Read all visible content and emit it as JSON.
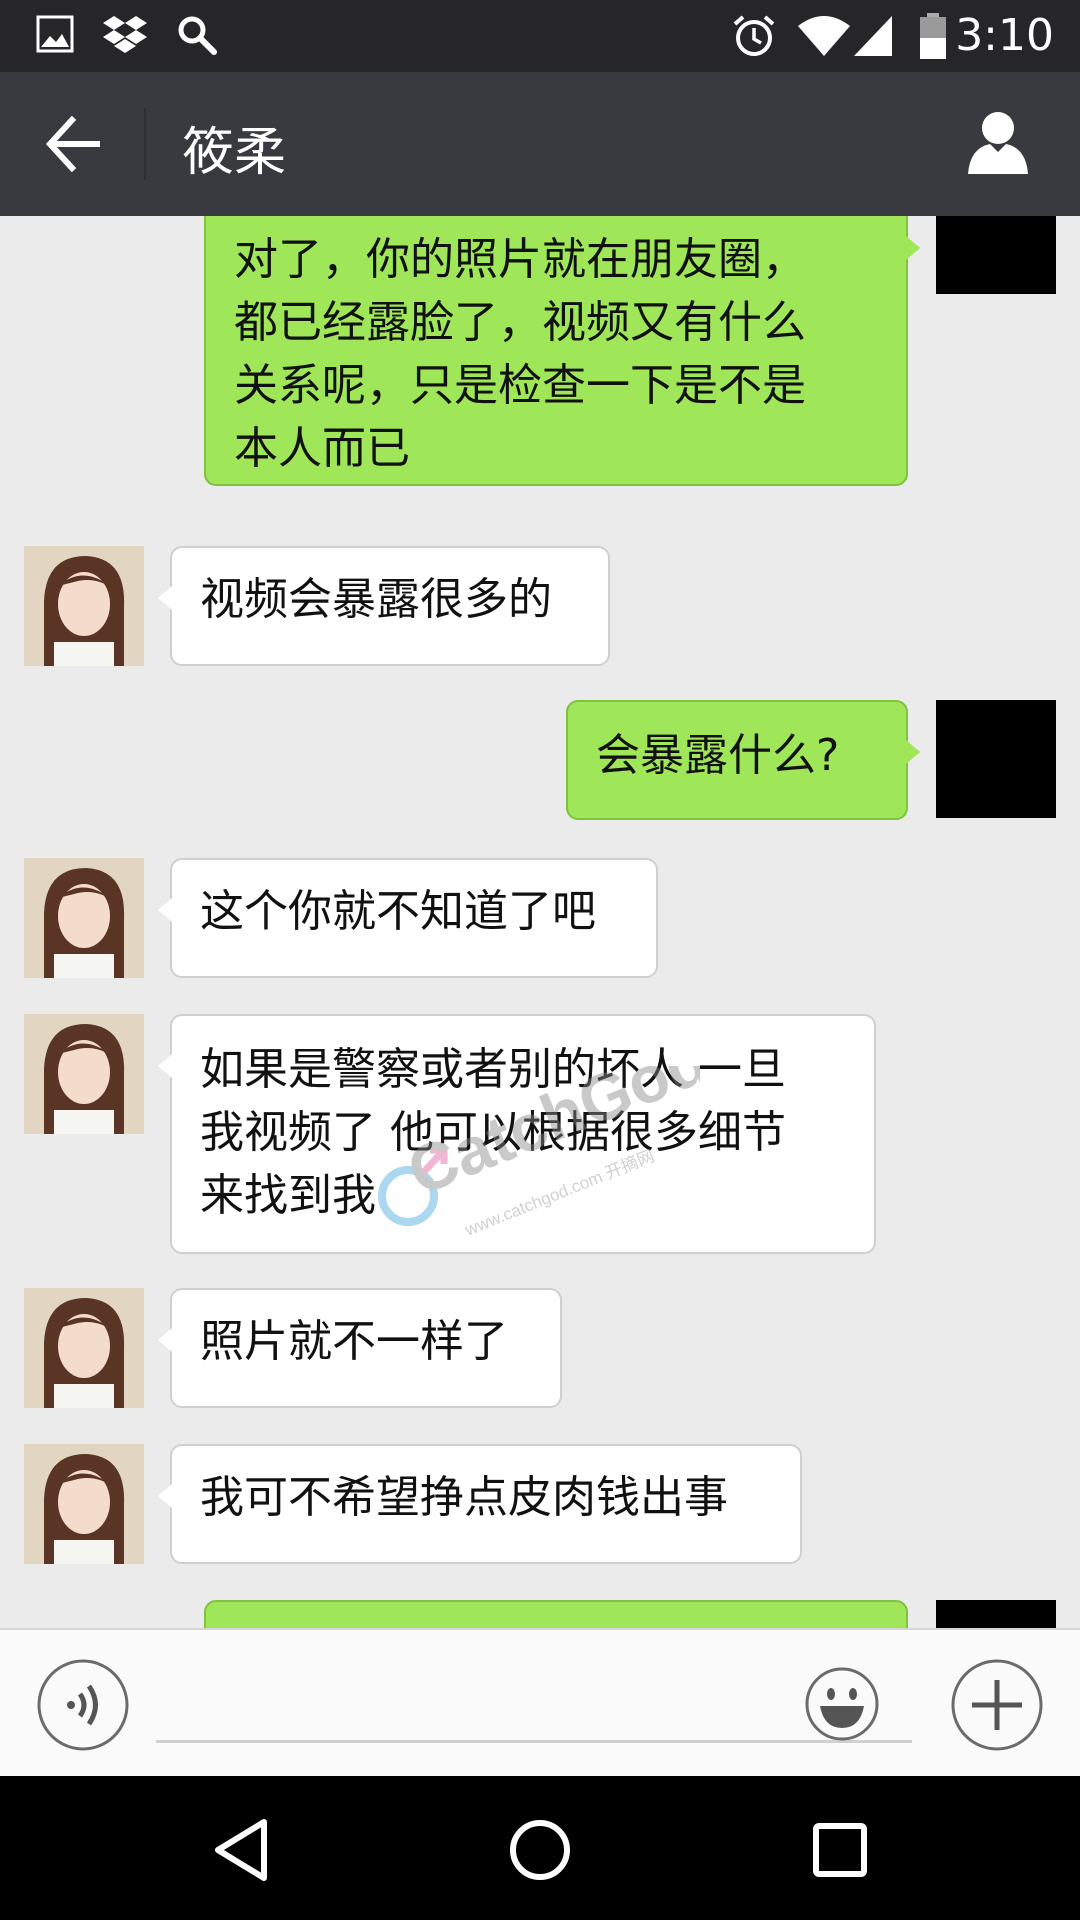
{
  "status_bar": {
    "time": "3:10"
  },
  "header": {
    "title": "筱柔"
  },
  "messages": [
    {
      "side": "out",
      "text": "对了，你的照片就在朋友圈，\n都已经露脸了，视频又有什么\n关系呢，只是检查一下是不是\n本人而已"
    },
    {
      "side": "in",
      "text": "视频会暴露很多的"
    },
    {
      "side": "out",
      "text": "会暴露什么?"
    },
    {
      "side": "in",
      "text": "这个你就不知道了吧"
    },
    {
      "side": "in",
      "text": "如果是警察或者别的坏人 一旦\n我视频了 他可以根据很多细节\n来找到我"
    },
    {
      "side": "in",
      "text": "照片就不一样了"
    },
    {
      "side": "in",
      "text": "我可不希望挣点皮肉钱出事"
    },
    {
      "side": "out",
      "text": ""
    }
  ],
  "watermark": {
    "brand": "CatchGod",
    "url": "www.catchgod.com 开摘网"
  },
  "input_bar": {
    "value": ""
  },
  "colors": {
    "outgoing_bubble": "#9fe658",
    "incoming_bubble": "#ffffff",
    "header": "#393a3f",
    "status_bar": "#262629",
    "chat_bg": "#ebebeb"
  }
}
